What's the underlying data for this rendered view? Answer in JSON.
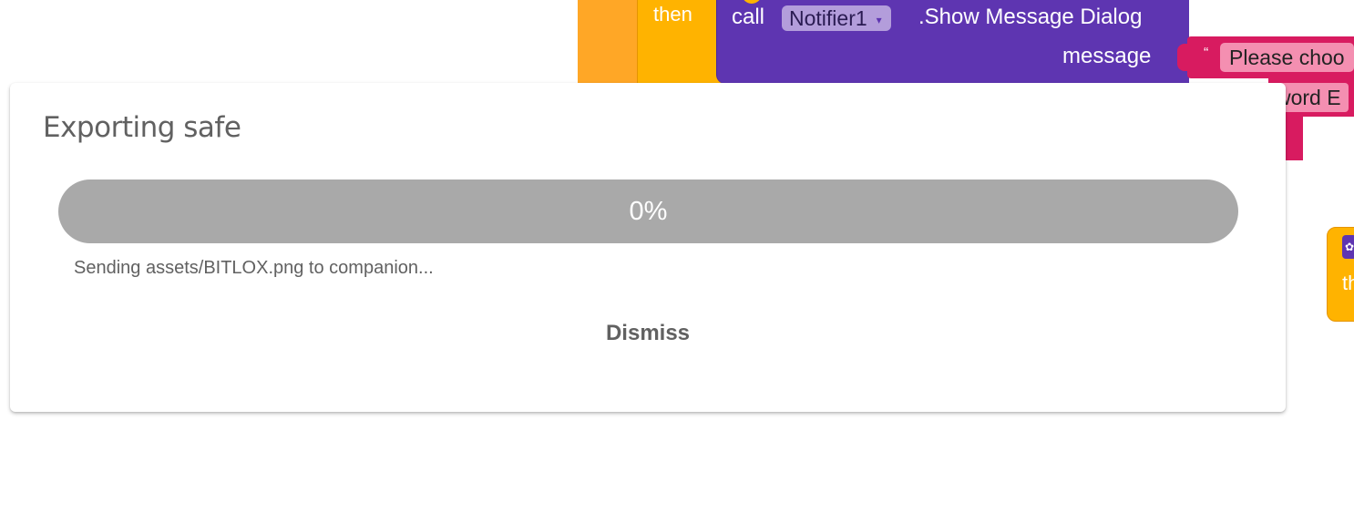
{
  "blocks": {
    "then_label": "then",
    "call_label": "call",
    "component": "Notifier1",
    "dropdown_arrow": "▾",
    "method": ".Show Message Dialog",
    "message_label": "message",
    "quote": "“",
    "text_value": "Please choo",
    "text_value_2": "word E",
    "side_block_label": "th"
  },
  "dialog": {
    "title": "Exporting safe",
    "progress": {
      "value_percent": 0,
      "label": "0%"
    },
    "status": "Sending assets/BITLOX.png to companion...",
    "dismiss_label": "Dismiss"
  },
  "colors": {
    "progress_track": "#a9a9a9",
    "block_purple": "#5e35b1",
    "block_orange": "#ffb300",
    "block_pink": "#d81b60"
  }
}
